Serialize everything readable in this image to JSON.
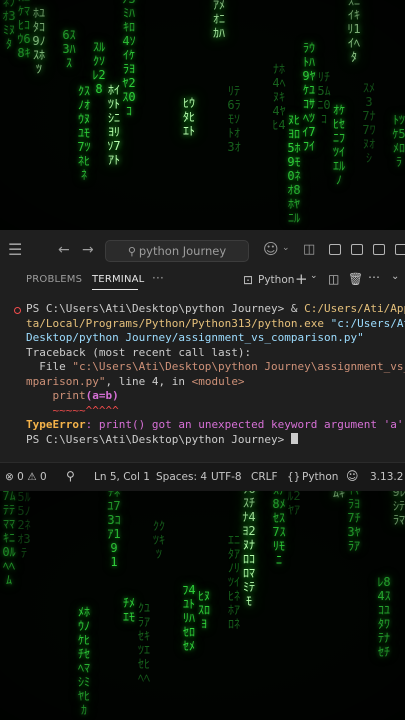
{
  "colors": {
    "matrix_green": "#2fcf3a",
    "editor_bg": "#1f1f1f",
    "error_red": "#f14c4c",
    "error_type": "#f5b34a",
    "magenta": "#d670d6"
  },
  "titlebar": {
    "search_text": "python Journey",
    "icons": [
      "menu-icon",
      "back-arrow-icon",
      "forward-arrow-icon",
      "copilot-icon",
      "layout-icons",
      "minimize-icon"
    ]
  },
  "panel": {
    "tabs": {
      "problems": "PROBLEMS",
      "terminal": "TERMINAL",
      "more": "···"
    },
    "terminal_name": "Python",
    "actions": [
      "new-terminal-icon",
      "split-icon",
      "trash-icon",
      "more-icon",
      "minimize-panel-icon"
    ]
  },
  "terminal": {
    "line1_prompt": "PS C:\\Users\\Ati\\Desktop\\python Journey> & ",
    "line1_path": "C:/Users/Ati/App",
    "line2_path": "ta/Local/Programs/Python/Python313/python.exe",
    "line2_arg": " \"c:/Users/At",
    "line3_arg": "Desktop/python Journey/assignment_vs_comparison.py\"",
    "traceback": "Traceback (most recent call last):",
    "file_prefix": "  File ",
    "file_path1": "\"c:\\Users\\Ati\\Desktop\\python Journey\\assignment_vs_",
    "file_path2": "mparison.py\"",
    "file_rest": ", line 4, in ",
    "file_module": "<module>",
    "code_indent": "    ",
    "code_print": "print",
    "code_args": "(a=b)",
    "caret_line": "    ~~~~~^^^^^",
    "error_type": "TypeError",
    "error_msg": ": print() got an unexpected keyword argument 'a'",
    "final_prompt": "PS C:\\Users\\Ati\\Desktop\\python Journey> "
  },
  "statusbar": {
    "errors": "0",
    "warnings": "0",
    "position": "Ln 5, Col 1",
    "spaces": "Spaces: 4",
    "encoding": "UTF-8",
    "eol": "CRLF",
    "braces": "{}",
    "language": "Python",
    "version": "3.13.2"
  }
}
